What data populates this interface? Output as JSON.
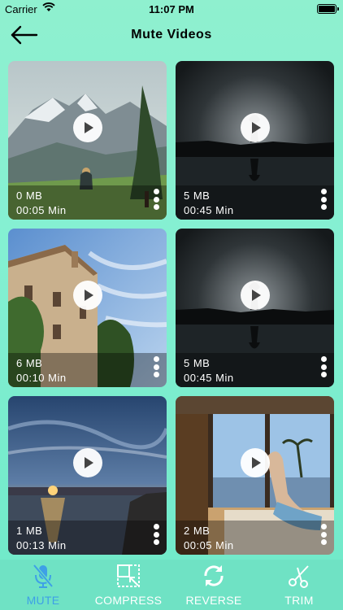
{
  "status": {
    "carrier": "Carrier",
    "time": "11:07 PM"
  },
  "nav": {
    "title": "Mute Videos",
    "back_icon": "arrow-left-icon"
  },
  "videos": [
    {
      "size": "0 MB",
      "duration": "00:05 Min",
      "thumb": "mountain-meadow"
    },
    {
      "size": "5 MB",
      "duration": "00:45 Min",
      "thumb": "dark-lake-tree"
    },
    {
      "size": "6 MB",
      "duration": "00:10 Min",
      "thumb": "stone-house"
    },
    {
      "size": "5 MB",
      "duration": "00:45 Min",
      "thumb": "dark-lake-tree"
    },
    {
      "size": "1 MB",
      "duration": "00:13 Min",
      "thumb": "sunset-coast"
    },
    {
      "size": "2 MB",
      "duration": "00:05 Min",
      "thumb": "woman-window"
    }
  ],
  "tabs": [
    {
      "label": "MUTE",
      "icon": "mic-off-icon",
      "active": true
    },
    {
      "label": "COMPRESS",
      "icon": "compress-icon",
      "active": false
    },
    {
      "label": "REVERSE",
      "icon": "reverse-icon",
      "active": false
    },
    {
      "label": "TRIM",
      "icon": "scissors-icon",
      "active": false
    }
  ],
  "colors": {
    "accent": "#3ea0e6",
    "background": "#84f0d2"
  }
}
